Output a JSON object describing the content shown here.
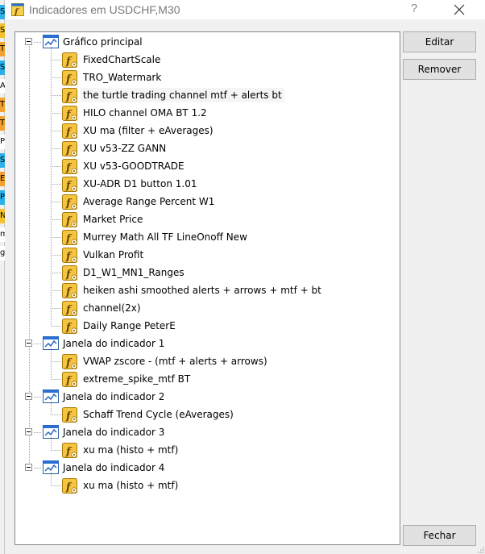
{
  "window": {
    "title": "Indicadores em USDCHF,M30",
    "help": "?"
  },
  "buttons": {
    "edit": "Editar",
    "remove": "Remover",
    "close": "Fechar"
  },
  "tree": {
    "groups": [
      {
        "label": "Gráfico principal",
        "items": [
          "FixedChartScale",
          "TRO_Watermark",
          "the turtle trading channel mtf + alerts bt",
          "HILO channel OMA BT 1.2",
          "XU ma (filter + eAverages)",
          "XU v53-ZZ GANN",
          "XU v53-GOODTRADE",
          "XU-ADR D1 button 1.01",
          "Average Range Percent W1",
          "Market Price",
          "Murrey Math All TF LineOnoff New",
          "Vulkan Profit",
          "D1_W1_MN1_Ranges",
          "heiken ashi smoothed alerts + arrows + mtf + bt",
          "channel(2x)",
          "Daily Range PeterE"
        ]
      },
      {
        "label": "Janela do indicador 1",
        "items": [
          "VWAP zscore - (mtf + alerts  + arrows)",
          "extreme_spike_mtf BT"
        ]
      },
      {
        "label": "Janela do indicador 2",
        "items": [
          "Schaff Trend Cycle (eAverages)"
        ]
      },
      {
        "label": "Janela do indicador 3",
        "items": [
          "xu ma (histo + mtf)"
        ]
      },
      {
        "label": "Janela do indicador 4",
        "items": [
          "xu ma (histo + mtf)"
        ]
      }
    ]
  },
  "selected_item": "the turtle trading channel mtf + alerts bt",
  "background_app": {
    "visible_letters": [
      "S",
      "S",
      "T",
      "S",
      "A",
      "T",
      "T",
      "P",
      "S",
      "E",
      "P",
      "N",
      "m",
      "g"
    ]
  },
  "colors": {
    "dialog_bg": "#f0f0f0",
    "tree_bg": "#ffffff",
    "tree_border": "#828790",
    "button_bg": "#e1e1e1",
    "button_border": "#adadad",
    "title_text": "#7a7a7a",
    "fn_icon_fill": "#f5c542",
    "window_icon_blue": "#1f6fd1"
  },
  "icons": {
    "group": "chart-window-icon",
    "item": "custom-indicator-fx-icon",
    "app": "indicator-list-icon",
    "close": "close-icon"
  }
}
